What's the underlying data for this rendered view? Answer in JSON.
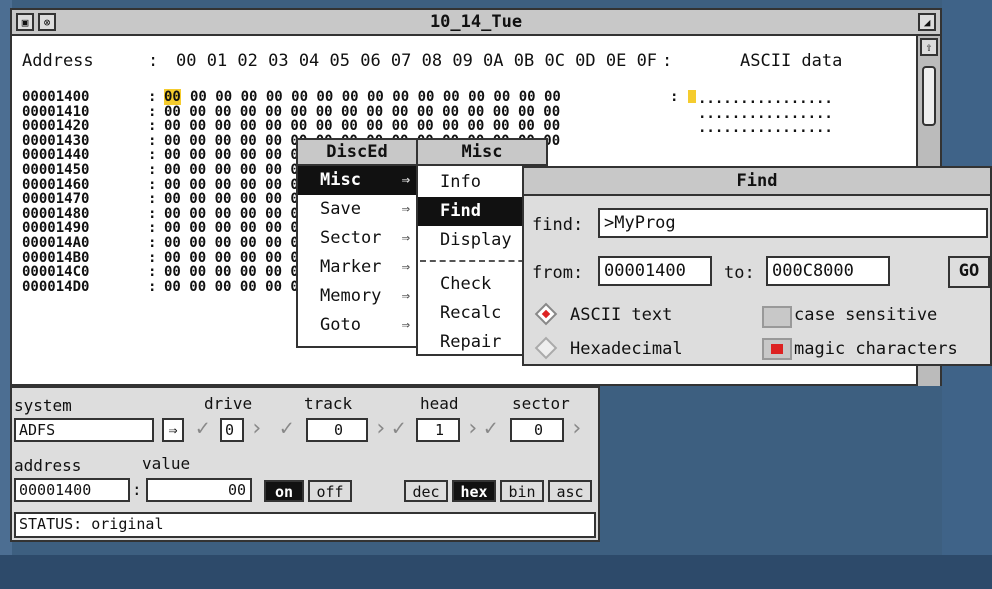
{
  "window": {
    "title": "10_14_Tue",
    "header_address": "Address",
    "header_colon": ":",
    "header_bytes": "00 01 02 03 04 05 06 07 08 09 0A 0B 0C 0D 0E 0F",
    "header_colon2": ":",
    "header_ascii": "ASCII data",
    "first_byte": "00",
    "addresses": "00001400\n00001410\n00001420\n00001430\n00001440\n00001450\n00001460\n00001470\n00001480\n00001490\n000014A0\n000014B0\n000014C0\n000014D0",
    "colons": ":\n:\n:\n:\n:\n:\n:\n:\n:\n:\n:\n:\n:\n:",
    "row0_bytes": "00 00 00 00 00 00 00 00 00 00 00 00 00 00 00",
    "row_bytes": "00 00 00 00 00 00 00 00 00 00 00 00 00 00 00 00\n00 00 00 00 00 00 00 00 00 00 00 00 00 00 00 00\n00 00 00 00 00 00 00 00 00 00 00 00 00 00 00 00\n00 00 00 00 00 0\n00 00 00 00 00 0\n00 00 00 00 00 0\n00 00 00 00 00 0\n00 00 00 00 00 0\n00 00 00 00 00 0\n00 00 00 00 00 0\n00 00 00 00 00 0\n00 00 00 00 00 00 00 00 00 00 00 00 00 00 00 00\n00 00 00 00 00 00 00 00 00 00 00 00 00 00 00 00",
    "ascii_rows": "................\n................\n................"
  },
  "menu_disced": {
    "title": "DiscEd",
    "items": [
      "Misc",
      "Save",
      "Sector",
      "Marker",
      "Memory",
      "Goto"
    ],
    "selected": "Misc"
  },
  "menu_misc": {
    "title": "Misc",
    "items": [
      "Info",
      "Find",
      "Display",
      "Check",
      "Recalc",
      "Repair"
    ],
    "selected": "Find"
  },
  "find_dialog": {
    "title": "Find",
    "find_label": "find:",
    "find_value": ">MyProg",
    "from_label": "from:",
    "from_value": "00001400",
    "to_label": "to:",
    "to_value": "000C8000",
    "go_label": "GO",
    "ascii_option": "ASCII text",
    "hex_option": "Hexadecimal",
    "case_label": "case sensitive",
    "magic_label": "magic characters"
  },
  "panel": {
    "system_label": "system",
    "system_value": "ADFS",
    "drive_label": "drive",
    "drive_value": "0",
    "track_label": "track",
    "track_value": "0",
    "head_label": "head",
    "head_value": "1",
    "sector_label": "sector",
    "sector_value": "0",
    "address_label": "address",
    "value_label": "value",
    "address_value": "00001400",
    "address_colon": ":",
    "value_value": "00",
    "on_label": "on",
    "off_label": "off",
    "dec_label": "dec",
    "hex_label": "hex",
    "bin_label": "bin",
    "asc_label": "asc",
    "status": "STATUS: original"
  },
  "colors": {
    "desktop": "#3d5f80",
    "highlight": "#f5cc2e",
    "window_bg": "#ffffff",
    "chrome": "#c8c8c8"
  },
  "icons": [
    "back-icon",
    "close-icon",
    "toggle-size-icon",
    "scroll-up-icon",
    "submenu-arrow-icon",
    "radio-selected-icon",
    "radio-unselected-icon"
  ]
}
